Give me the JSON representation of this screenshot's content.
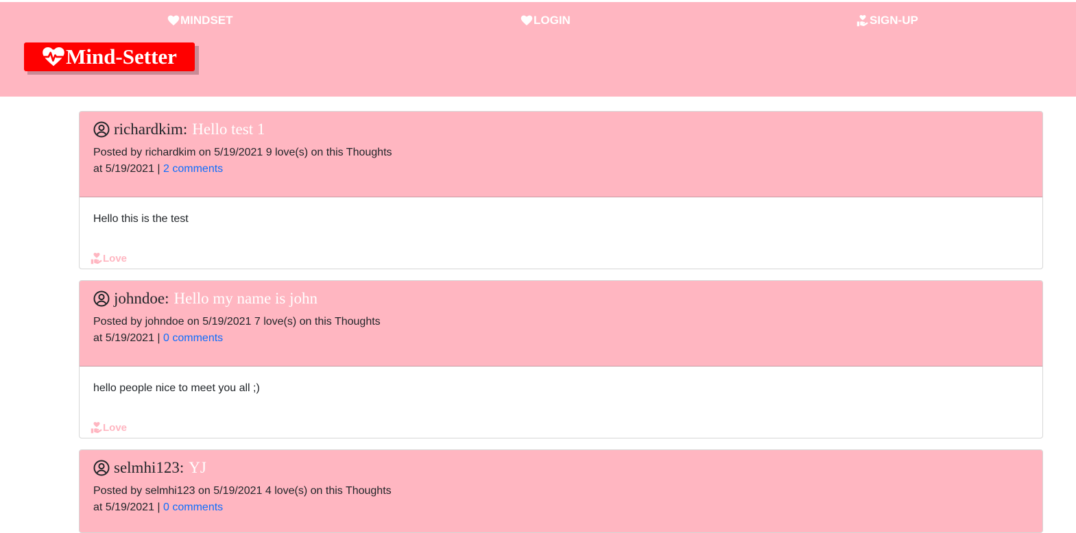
{
  "nav": {
    "mindset_label": "MINDSET",
    "login_label": "LOGIN",
    "signup_label": "SIGN-UP"
  },
  "brand": {
    "name": "Mind-Setter"
  },
  "colors": {
    "header_bg": "#ffb6c1",
    "logo_bg": "#ff0000",
    "link": "#0d6efd",
    "love": "#ffb6c1"
  },
  "icons": {
    "nav_mindset": "heart-icon",
    "nav_login": "heart-icon",
    "nav_signup": "hand-holding-heart-icon",
    "logo": "heartbeat-icon",
    "user": "user-circle-icon",
    "love": "hand-holding-heart-icon"
  },
  "thoughts": [
    {
      "username": "richardkim",
      "separator": ":",
      "title": "Hello test 1",
      "meta_line1": "Posted by richardkim on 5/19/2021 9 love(s) on this Thoughts",
      "meta_line2_prefix": "at 5/19/2021 | ",
      "comments": "2 comments",
      "body": "Hello this is the test",
      "love_label": "Love"
    },
    {
      "username": "johndoe",
      "separator": ":",
      "title": "Hello my name is john",
      "meta_line1": "Posted by johndoe on 5/19/2021 7 love(s) on this Thoughts",
      "meta_line2_prefix": "at 5/19/2021 | ",
      "comments": "0 comments",
      "body": "hello people nice to meet you all ;)",
      "love_label": "Love"
    },
    {
      "username": "selmhi123",
      "separator": ":",
      "title": "YJ",
      "meta_line1": "Posted by selmhi123 on 5/19/2021 4 love(s) on this Thoughts",
      "meta_line2_prefix": "at 5/19/2021 | ",
      "comments": "0 comments"
    }
  ]
}
